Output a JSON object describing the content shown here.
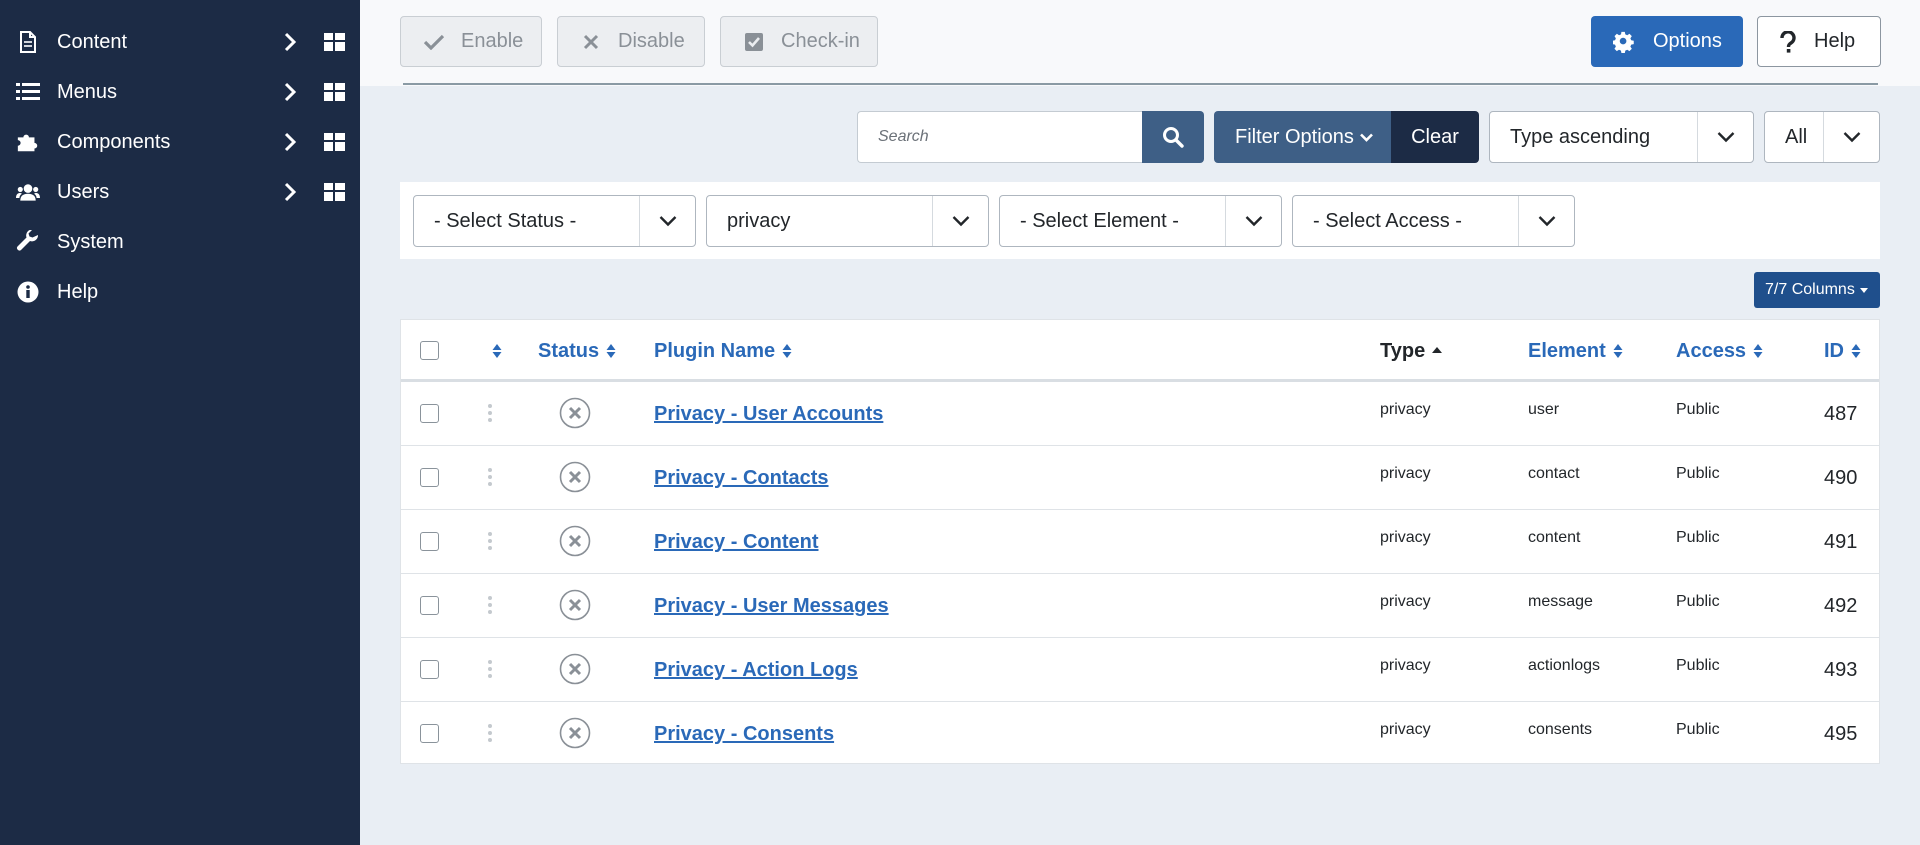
{
  "sidebar": {
    "items": [
      {
        "label": "Content",
        "icon": "file-icon",
        "has_children": true
      },
      {
        "label": "Menus",
        "icon": "list-icon",
        "has_children": true
      },
      {
        "label": "Components",
        "icon": "puzzle-icon",
        "has_children": true
      },
      {
        "label": "Users",
        "icon": "users-icon",
        "has_children": true
      },
      {
        "label": "System",
        "icon": "wrench-icon",
        "has_children": false
      },
      {
        "label": "Help",
        "icon": "info-icon",
        "has_children": false
      }
    ]
  },
  "toolbar": {
    "enable_label": "Enable",
    "disable_label": "Disable",
    "checkin_label": "Check-in",
    "options_label": "Options",
    "help_label": "Help"
  },
  "search": {
    "placeholder": "Search",
    "value": "",
    "filter_options_label": "Filter Options",
    "clear_label": "Clear",
    "ordering_value": "Type ascending",
    "limit_value": "All"
  },
  "filters": {
    "status": "- Select Status -",
    "type": "privacy",
    "element": "- Select Element -",
    "access": "- Select Access -"
  },
  "columns_button": "7/7 Columns",
  "table": {
    "headers": {
      "status": "Status",
      "plugin_name": "Plugin Name",
      "type": "Type",
      "element": "Element",
      "access": "Access",
      "id": "ID"
    },
    "rows": [
      {
        "name": "Privacy - User Accounts",
        "type": "privacy",
        "element": "user",
        "access": "Public",
        "id": "487",
        "status": "disabled"
      },
      {
        "name": "Privacy - Contacts",
        "type": "privacy",
        "element": "contact",
        "access": "Public",
        "id": "490",
        "status": "disabled"
      },
      {
        "name": "Privacy - Content",
        "type": "privacy",
        "element": "content",
        "access": "Public",
        "id": "491",
        "status": "disabled"
      },
      {
        "name": "Privacy - User Messages",
        "type": "privacy",
        "element": "message",
        "access": "Public",
        "id": "492",
        "status": "disabled"
      },
      {
        "name": "Privacy - Action Logs",
        "type": "privacy",
        "element": "actionlogs",
        "access": "Public",
        "id": "493",
        "status": "disabled"
      },
      {
        "name": "Privacy - Consents",
        "type": "privacy",
        "element": "consents",
        "access": "Public",
        "id": "495",
        "status": "disabled"
      }
    ]
  },
  "colors": {
    "sidebar_bg": "#1c2b45",
    "accent": "#2a69b8",
    "filter_button": "#3e5f86",
    "page_bg": "#e9eef4"
  }
}
